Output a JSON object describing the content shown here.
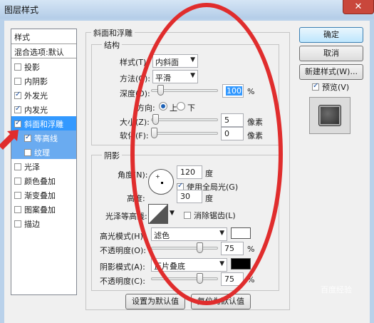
{
  "window": {
    "title": "图层样式",
    "close_glyph": "✕"
  },
  "stylelist": {
    "header": "样式",
    "blend_row": "混合选项:默认",
    "items": [
      {
        "label": "投影",
        "checked": false
      },
      {
        "label": "内阴影",
        "checked": false
      },
      {
        "label": "外发光",
        "checked": true
      },
      {
        "label": "内发光",
        "checked": true
      },
      {
        "label": "斜面和浮雕",
        "checked": true,
        "selected": true
      },
      {
        "label": "等高线",
        "checked": true,
        "sub": true
      },
      {
        "label": "纹理",
        "checked": false,
        "sub": true
      },
      {
        "label": "光泽",
        "checked": false
      },
      {
        "label": "颜色叠加",
        "checked": false
      },
      {
        "label": "渐变叠加",
        "checked": false
      },
      {
        "label": "图案叠加",
        "checked": false
      },
      {
        "label": "描边",
        "checked": false
      }
    ]
  },
  "bevel": {
    "group_title": "斜面和浮雕",
    "structure_title": "结构",
    "style_label": "样式(T):",
    "style_value": "内斜面",
    "method_label": "方法(Q):",
    "method_value": "平滑",
    "depth_label": "深度(D):",
    "depth_value": "100",
    "depth_unit": "%",
    "depth_level": 0.1,
    "direction_label": "方向:",
    "direction_up": "上",
    "direction_down": "下",
    "size_label": "大小(Z):",
    "size_value": "5",
    "size_unit": "像素",
    "size_level": 0.02,
    "soften_label": "软化(F):",
    "soften_value": "0",
    "soften_unit": "像素",
    "soften_level": 0.0
  },
  "shading": {
    "title": "阴影",
    "angle_label": "角度(N):",
    "angle_value": "120",
    "angle_unit": "度",
    "global_light_label": "使用全局光(G)",
    "global_light_checked": true,
    "altitude_label": "高度:",
    "altitude_value": "30",
    "altitude_unit": "度",
    "gloss_label": "光泽等高线:",
    "antialias_label": "消除锯齿(L)",
    "antialias_checked": false,
    "highlight_mode_label": "高光模式(H):",
    "highlight_mode_value": "滤色",
    "highlight_color": "#ffffff",
    "highlight_opacity_label": "不透明度(O):",
    "highlight_opacity_value": "75",
    "highlight_opacity_unit": "%",
    "highlight_opacity_level": 0.75,
    "shadow_mode_label": "阴影模式(A):",
    "shadow_mode_value": "正片叠底",
    "shadow_color": "#000000",
    "shadow_opacity_label": "不透明度(C):",
    "shadow_opacity_value": "75",
    "shadow_opacity_unit": "%",
    "shadow_opacity_level": 0.75
  },
  "buttons": {
    "ok": "确定",
    "cancel": "取消",
    "new_style": "新建样式(W)...",
    "preview_label": "预览(V)",
    "preview_checked": true,
    "set_default": "设置为默认值",
    "reset_default": "复位为默认值"
  },
  "watermark": "百度经验",
  "colors": {
    "annotation": "#e02d2d",
    "selection": "#3399ff"
  }
}
